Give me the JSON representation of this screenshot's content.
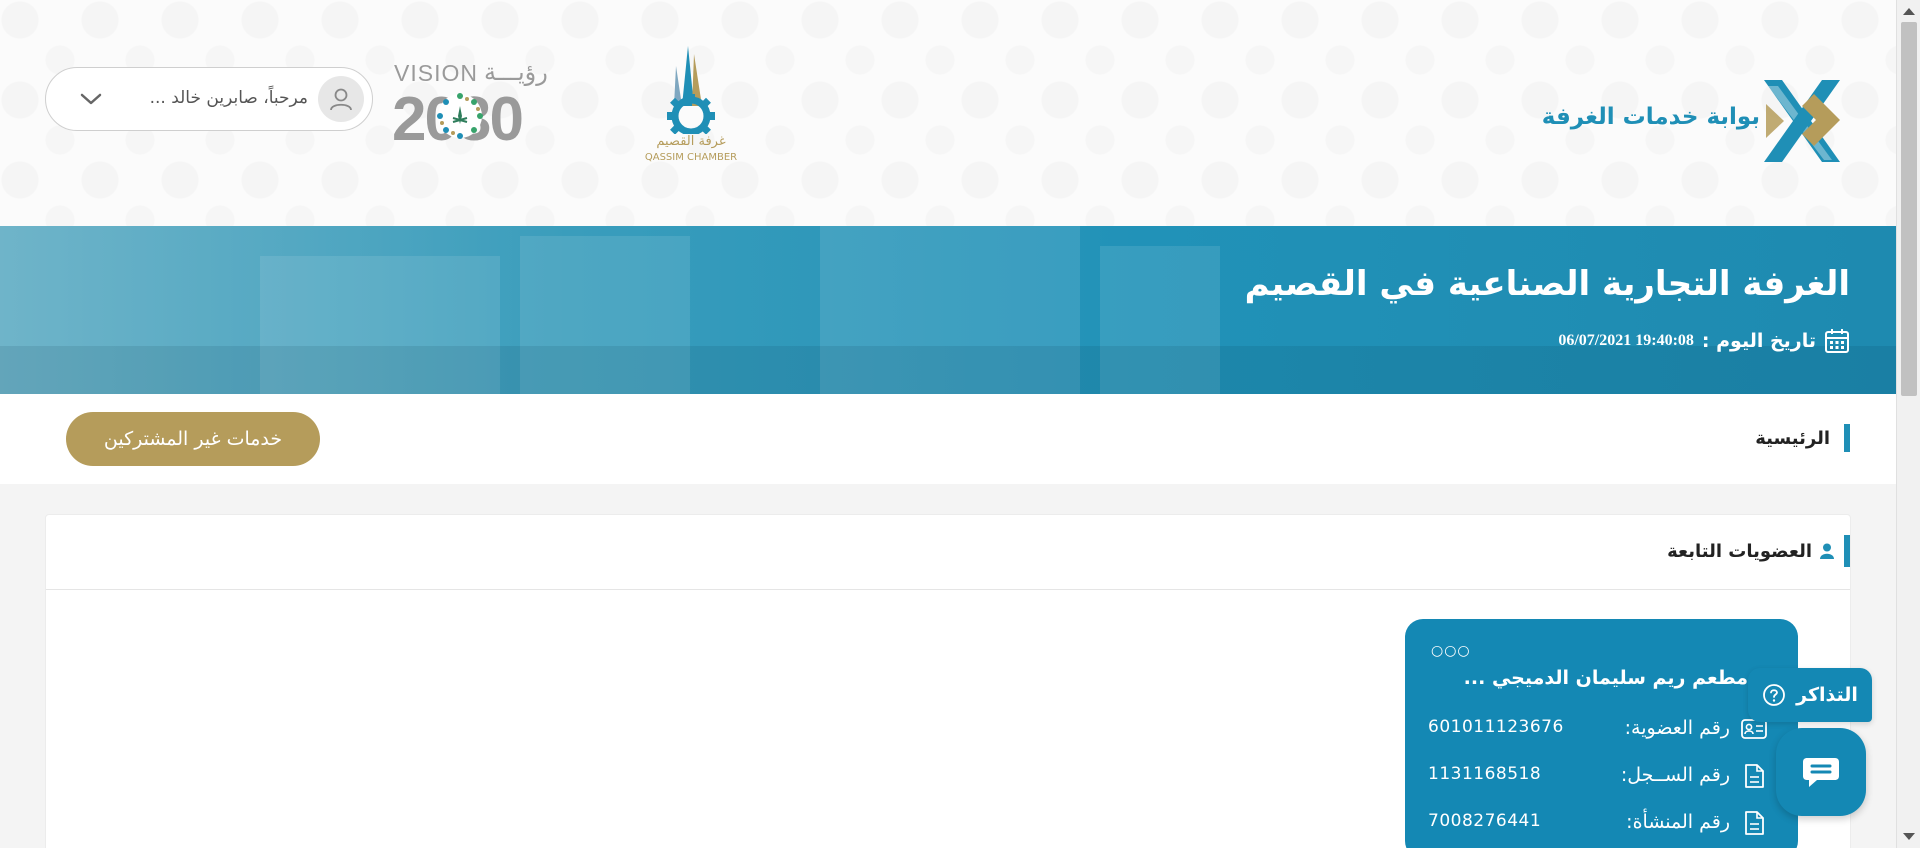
{
  "header": {
    "portal_title": "بوابة خدمات الغرفة",
    "chamber_logo": {
      "arabic": "غرفة القصيم",
      "english": "QASSIM CHAMBER"
    },
    "vision_logo": {
      "word_en": "VISION",
      "word_ar": "رؤيـــة",
      "year": "2030"
    },
    "user": {
      "greeting": "مرحباً، صابرين خالد ..."
    }
  },
  "banner": {
    "title": "الغرفة التجارية الصناعية في القصيم",
    "date_label": "تاريخ اليوم :",
    "date_value": "06/07/2021 19:40:08"
  },
  "nav": {
    "breadcrumb": "الرئيسية",
    "nonsubscriber_button": "خدمات غير المشتركين"
  },
  "memberships": {
    "section_title": "العضويات التابعة",
    "card": {
      "dots": "○○○",
      "name": "مطعم ريم سليمان الدميجي ...",
      "rows": [
        {
          "label": "رقم العضوية:",
          "value": "601011123676",
          "icon": "id-card-icon"
        },
        {
          "label": "رقم الســجل:",
          "value": "1131168518",
          "icon": "document-icon"
        },
        {
          "label": "رقم المنشأة:",
          "value": "7008276441",
          "icon": "document-icon"
        }
      ]
    }
  },
  "floating": {
    "tickets_label": "التذاكر"
  },
  "colors": {
    "primary": "#1488b4",
    "gold": "#b59c5b",
    "teal_text": "#1f8fb6"
  }
}
